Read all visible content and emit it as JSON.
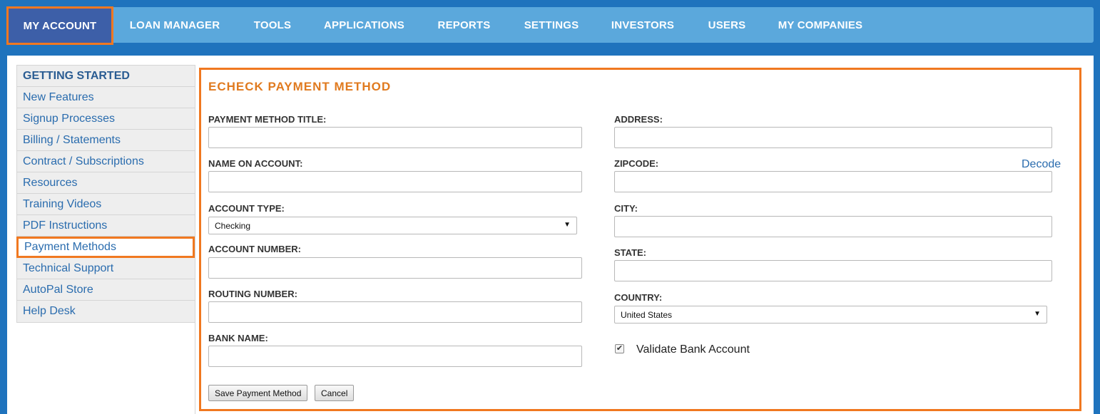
{
  "nav": {
    "items": [
      {
        "label": "MY ACCOUNT",
        "active": true
      },
      {
        "label": "LOAN MANAGER"
      },
      {
        "label": "TOOLS"
      },
      {
        "label": "APPLICATIONS"
      },
      {
        "label": "REPORTS"
      },
      {
        "label": "SETTINGS"
      },
      {
        "label": "INVESTORS"
      },
      {
        "label": "USERS"
      },
      {
        "label": "MY COMPANIES"
      }
    ]
  },
  "sidebar": {
    "heading": "GETTING STARTED",
    "items": [
      {
        "label": "New Features"
      },
      {
        "label": "Signup Processes"
      },
      {
        "label": "Billing / Statements"
      },
      {
        "label": "Contract / Subscriptions"
      },
      {
        "label": "Resources"
      },
      {
        "label": "Training Videos"
      },
      {
        "label": "PDF Instructions"
      },
      {
        "label": "Payment Methods",
        "active": true
      },
      {
        "label": "Technical Support"
      },
      {
        "label": "AutoPal Store"
      },
      {
        "label": "Help Desk"
      }
    ]
  },
  "form": {
    "title": "ECHECK PAYMENT METHOD",
    "payment_method_title": {
      "label": "PAYMENT METHOD TITLE:",
      "value": ""
    },
    "name_on_account": {
      "label": "NAME ON ACCOUNT:",
      "value": ""
    },
    "account_type": {
      "label": "ACCOUNT TYPE:",
      "selected": "Checking"
    },
    "account_number": {
      "label": "ACCOUNT NUMBER:",
      "value": ""
    },
    "routing_number": {
      "label": "ROUTING NUMBER:",
      "value": ""
    },
    "bank_name": {
      "label": "BANK NAME:",
      "value": ""
    },
    "address": {
      "label": "ADDRESS:",
      "value": ""
    },
    "zipcode": {
      "label": "ZIPCODE:",
      "value": "",
      "decode_label": "Decode"
    },
    "city": {
      "label": "CITY:",
      "value": ""
    },
    "state": {
      "label": "STATE:",
      "value": ""
    },
    "country": {
      "label": "COUNTRY:",
      "selected": "United States"
    },
    "validate": {
      "label": "Validate Bank Account",
      "checked": true,
      "check_glyph": "✔"
    },
    "save_label": "Save Payment Method",
    "cancel_label": "Cancel",
    "dropdown_glyph": "▼"
  },
  "colors": {
    "nav_bg": "#5ba8dc",
    "active_nav_bg": "#3d5fa8",
    "highlight": "#f07820",
    "link": "#2a6cae",
    "title": "#e07a1f"
  }
}
